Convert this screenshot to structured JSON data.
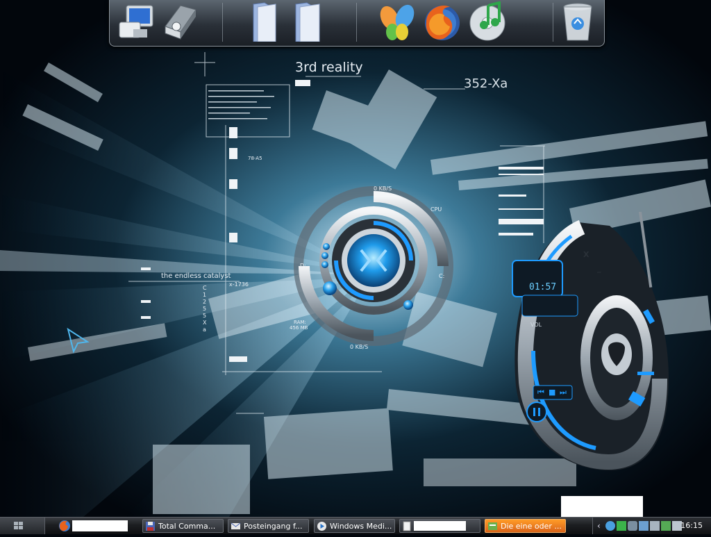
{
  "wallpaper": {
    "title": "3rd reality",
    "code": "352-Xa",
    "subtitle": "the endless catalyst",
    "small_label_1": "78-A5",
    "small_label_2": "x-1736",
    "vertical_code": "C 1 2 5 5 X a"
  },
  "system_monitor": {
    "net_top": "0 KB/S",
    "net_bottom": "0 KB/S",
    "cpu_label": "CPU",
    "drive_c": "C:",
    "drive_d": "D:",
    "ram": "RAM:",
    "ram_value": "456 MB"
  },
  "media_player": {
    "time": "01:57",
    "vol_label": "VOL",
    "close": "X",
    "minimize": "_"
  },
  "dock": {
    "icons": [
      "my-computer-icon",
      "network-icon",
      "folder-icon",
      "folder-icon",
      "msn-butterfly-icon",
      "firefox-icon",
      "itunes-icon",
      "recycle-bin-icon"
    ]
  },
  "taskbar": {
    "tasks": [
      {
        "label": "Total Comma...",
        "icon": "floppy-icon"
      },
      {
        "label": "Posteingang f...",
        "icon": "mail-icon"
      },
      {
        "label": "Windows Medi...",
        "icon": "media-icon"
      },
      {
        "label": "",
        "icon": "document-icon"
      },
      {
        "label": "Die eine oder ...",
        "icon": "browser-icon"
      }
    ],
    "active_index": 4,
    "clock": "16:15"
  },
  "colors": {
    "accent_blue": "#1e9bff",
    "taskbar_active": "#f0882a",
    "wallpaper_bg": "#02060c"
  }
}
